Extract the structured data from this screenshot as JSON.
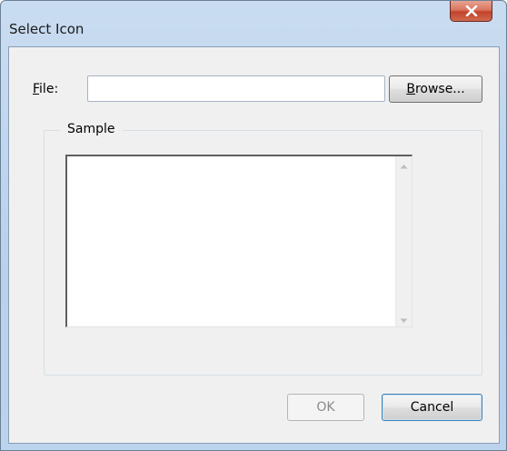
{
  "window": {
    "title": "Select Icon"
  },
  "file": {
    "label_prefix": "",
    "label_accel": "F",
    "label_rest": "ile:",
    "value": "",
    "placeholder": ""
  },
  "browse_button": {
    "accel": "B",
    "rest": "rowse..."
  },
  "sample_group": {
    "label": "Sample"
  },
  "buttons": {
    "ok": "OK",
    "cancel": "Cancel"
  },
  "colors": {
    "close_button": "#c2432a",
    "title_bar": "#b9d1ec",
    "dialog_background": "#f0f0f0"
  },
  "icons": {
    "close": "close-icon",
    "scroll_up": "chevron-up-icon",
    "scroll_down": "chevron-down-icon"
  }
}
